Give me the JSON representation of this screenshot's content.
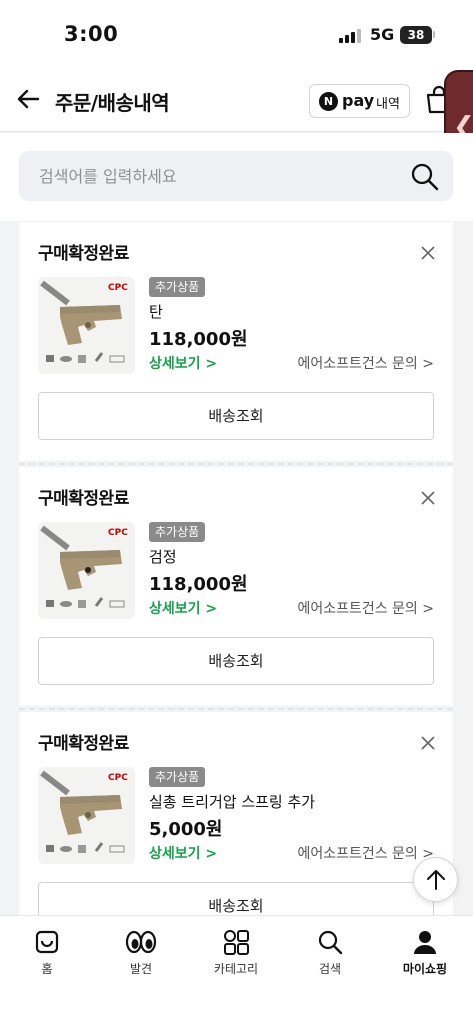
{
  "status_bar": {
    "time": "3:00",
    "network": "5G",
    "battery": "38"
  },
  "header": {
    "title": "주문/배송내역",
    "npay_word": "pay",
    "npay_label": "내역",
    "npay_logo": "N"
  },
  "search": {
    "placeholder": "검색어를 입력하세요"
  },
  "orders": [
    {
      "status": "구매확정완료",
      "badge": "추가상품",
      "option": "탄",
      "price": "118,000원",
      "detail": "상세보기 >",
      "inquiry": "에어소프트건스 문의 >",
      "track": "배송조회"
    },
    {
      "status": "구매확정완료",
      "badge": "추가상품",
      "option": "검정",
      "price": "118,000원",
      "detail": "상세보기 >",
      "inquiry": "에어소프트건스 문의 >",
      "track": "배송조회"
    },
    {
      "status": "구매확정완료",
      "badge": "추가상품",
      "option": "실총 트리거압 스프링 추가",
      "price": "5,000원",
      "detail": "상세보기 >",
      "inquiry": "에어소프트건스 문의 >",
      "track": "배송조회"
    }
  ],
  "thumb_brand": "CPC",
  "bottom_nav": [
    {
      "label": "홈",
      "icon": "home-icon"
    },
    {
      "label": "발견",
      "icon": "eyes-icon"
    },
    {
      "label": "카테고리",
      "icon": "category-icon"
    },
    {
      "label": "검색",
      "icon": "search-icon"
    },
    {
      "label": "마이쇼핑",
      "icon": "person-icon",
      "active": true
    }
  ],
  "colors": {
    "accent_green": "#16a34a",
    "handle": "#6e2a2c",
    "badge": "#8a8a8a"
  }
}
